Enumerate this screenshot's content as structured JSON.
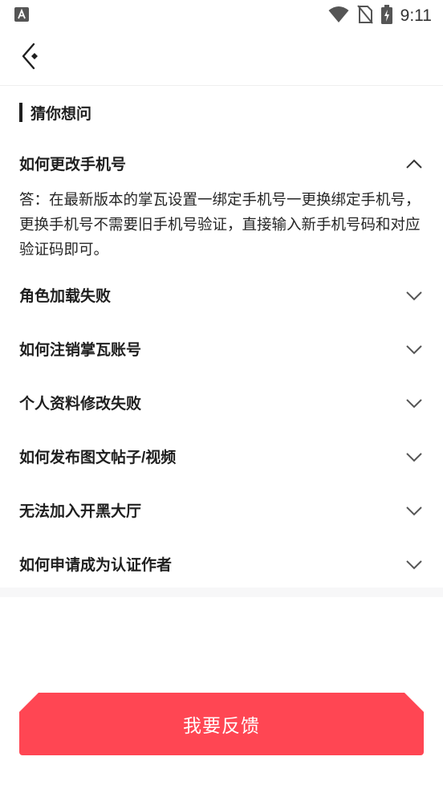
{
  "status_bar": {
    "time": "9:11",
    "icons": [
      "app-a-icon",
      "wifi-icon",
      "no-sim-icon",
      "battery-charging-icon"
    ]
  },
  "nav": {
    "back_icon": "back-arrow-icon"
  },
  "section": {
    "title": "猜你想问"
  },
  "faq": {
    "items": [
      {
        "question": "如何更改手机号",
        "expanded": true,
        "answer": "答：在最新版本的掌瓦设置一绑定手机号一更换绑定手机号，更换手机号不需要旧手机号验证，直接输入新手机号码和对应验证码即可。"
      },
      {
        "question": "角色加载失败",
        "expanded": false
      },
      {
        "question": "如何注销掌瓦账号",
        "expanded": false
      },
      {
        "question": "个人资料修改失败",
        "expanded": false
      },
      {
        "question": "如何发布图文帖子/视频",
        "expanded": false
      },
      {
        "question": "无法加入开黑大厅",
        "expanded": false
      },
      {
        "question": "如何申请成为认证作者",
        "expanded": false
      }
    ]
  },
  "feedback_button": {
    "label": "我要反馈",
    "color": "#ff4653"
  }
}
